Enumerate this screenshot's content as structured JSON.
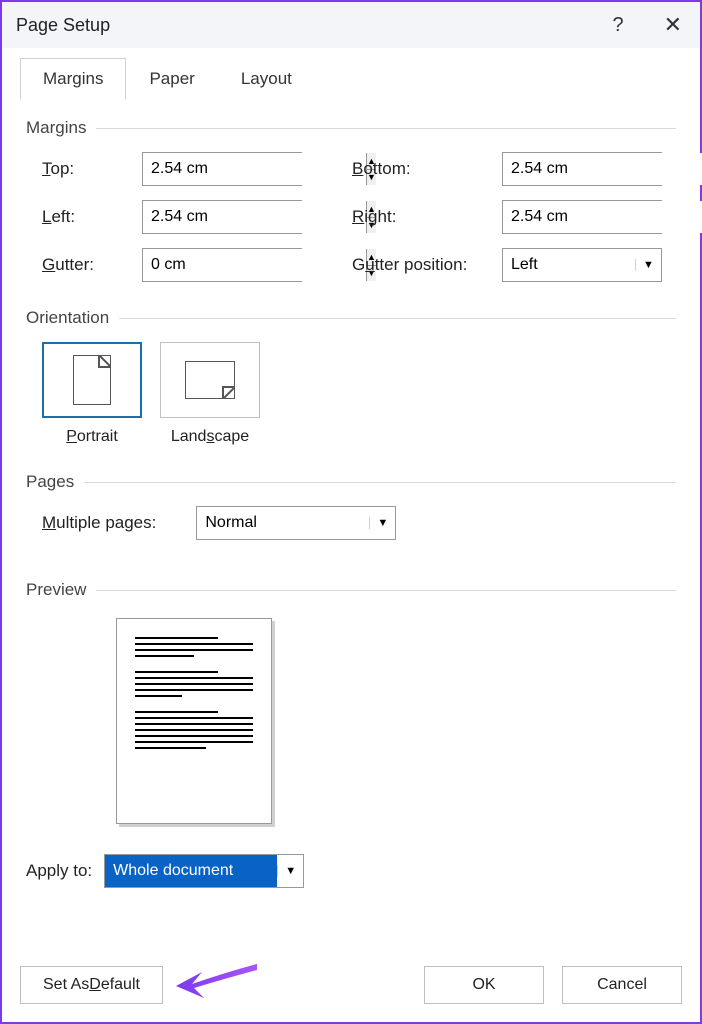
{
  "titlebar": {
    "title": "Page Setup",
    "help": "?",
    "close": "✕"
  },
  "tabs": {
    "margins": "Margins",
    "paper": "Paper",
    "layout": "Layout"
  },
  "groups": {
    "margins": "Margins",
    "orientation": "Orientation",
    "pages": "Pages",
    "preview": "Preview"
  },
  "labels": {
    "top": "op:",
    "top_pre": "T",
    "bottom": "ottom:",
    "bottom_pre": "B",
    "left": "eft:",
    "left_pre": "L",
    "right": "ight:",
    "right_pre": "R",
    "gutter": "utter:",
    "gutter_pre": "G",
    "gutter_pos": "tter position:",
    "gutter_pos_pre": "Gu",
    "portrait": "ortrait",
    "portrait_pre": "P",
    "landscape": "cape",
    "landscape_pre": "Lands",
    "multiple": "ultiple pages:",
    "multiple_pre": "M",
    "apply": "Apply to:"
  },
  "values": {
    "top": "2.54 cm",
    "bottom": "2.54 cm",
    "left": "2.54 cm",
    "right": "2.54 cm",
    "gutter": "0 cm",
    "gutter_pos": "Left",
    "multiple": "Normal",
    "apply": "Whole document"
  },
  "buttons": {
    "set_default_pre": "Set As ",
    "set_default_u": "D",
    "set_default_post": "efault",
    "ok": "OK",
    "cancel": "Cancel"
  }
}
